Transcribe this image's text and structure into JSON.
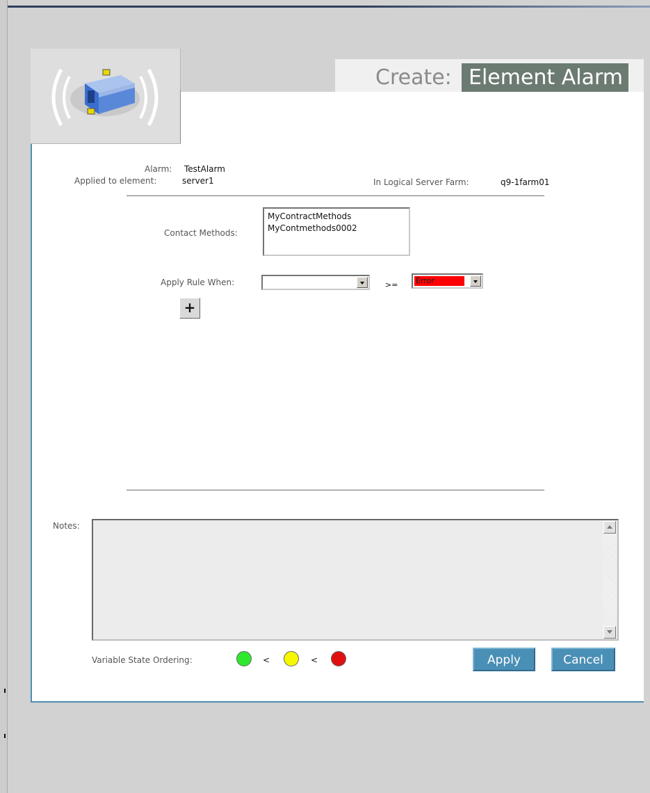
{
  "header": {
    "create_label": "Create:",
    "title": "Element Alarm"
  },
  "info": {
    "alarm_label": "Alarm:",
    "alarm_value": "TestAlarm",
    "applied_label": "Applied to element:",
    "applied_value": "server1",
    "farm_label": "In Logical Server Farm:",
    "farm_value": "q9-1farm01"
  },
  "contact": {
    "label": "Contact Methods:",
    "items": [
      "MyContractMethods",
      "MyContmethods0002"
    ]
  },
  "rule": {
    "label": "Apply Rule When:",
    "condition_value": "",
    "operator": ">=",
    "severity_value": "Error",
    "add_label": "+"
  },
  "notes": {
    "label": "Notes:",
    "value": ""
  },
  "ordering": {
    "label": "Variable State Ordering:",
    "separator": "<",
    "colors": [
      "#2ee82e",
      "#f7f700",
      "#e11010"
    ]
  },
  "buttons": {
    "apply": "Apply",
    "cancel": "Cancel"
  },
  "colors": {
    "accent": "#4a8fb5",
    "title_bg": "#6c7b72",
    "error_bg": "#ff0000"
  }
}
